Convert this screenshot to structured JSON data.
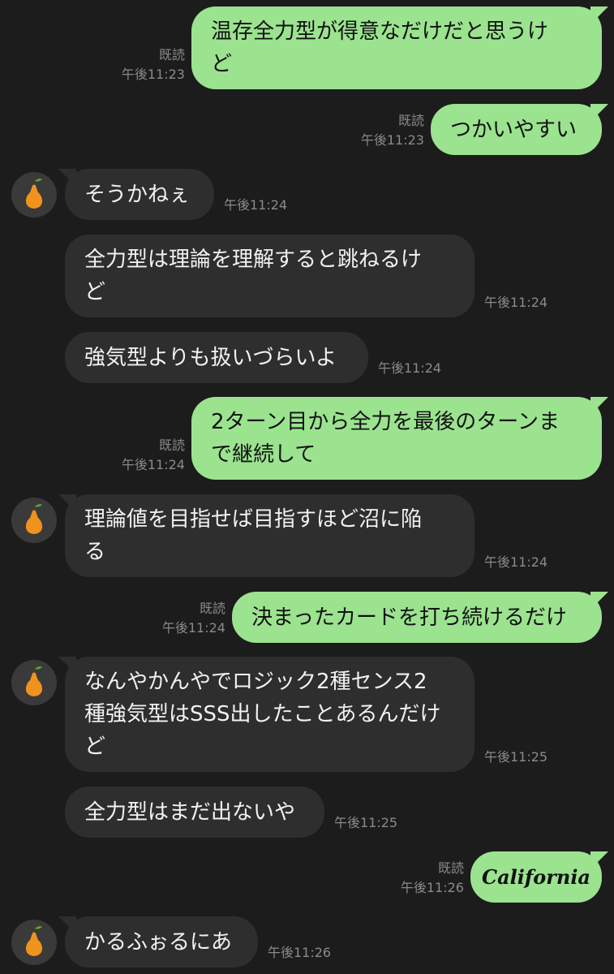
{
  "messages": [
    {
      "dir": "out",
      "text": "温存全力型が得意なだけだと思うけ\nど",
      "read": "既読",
      "time": "午後11:23"
    },
    {
      "dir": "out",
      "text": "つかいやすい",
      "read": "既読",
      "time": "午後11:23"
    },
    {
      "dir": "in",
      "text": "そうかねぇ",
      "time": "午後11:24",
      "avatar": true
    },
    {
      "dir": "in",
      "text": "全力型は理論を理解すると跳ねるけ\nど",
      "time": "午後11:24"
    },
    {
      "dir": "in",
      "text": "強気型よりも扱いづらいよ",
      "time": "午後11:24"
    },
    {
      "dir": "out",
      "text": "2ターン目から全力を最後のターンま\nで継続して",
      "read": "既読",
      "time": "午後11:24"
    },
    {
      "dir": "in",
      "text": "理論値を目指せば目指すほど沼に陥\nる",
      "time": "午後11:24",
      "avatar": true
    },
    {
      "dir": "out",
      "text": "決まったカードを打ち続けるだけ",
      "read": "既読",
      "time": "午後11:24"
    },
    {
      "dir": "in",
      "text": "なんやかんやでロジック2種センス2\n種強気型はSSS出したことあるんだけ\nど",
      "time": "午後11:25",
      "avatar": true
    },
    {
      "dir": "in",
      "text": "全力型はまだ出ないや",
      "time": "午後11:25"
    },
    {
      "dir": "out",
      "text": "California",
      "read": "既読",
      "time": "午後11:26",
      "sticker": true
    },
    {
      "dir": "in",
      "text": "かるふぉるにあ",
      "time": "午後11:26",
      "avatar": true
    }
  ]
}
